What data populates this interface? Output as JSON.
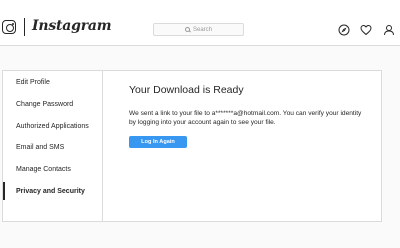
{
  "header": {
    "brand": "Instagram",
    "search_placeholder": "Search",
    "icons": [
      "instagram-glyph-icon",
      "search-icon",
      "explore-compass-icon",
      "activity-heart-icon",
      "profile-user-icon"
    ]
  },
  "sidebar": {
    "items": [
      {
        "label": "Edit Profile",
        "active": false
      },
      {
        "label": "Change Password",
        "active": false
      },
      {
        "label": "Authorized Applications",
        "active": false
      },
      {
        "label": "Email and SMS",
        "active": false
      },
      {
        "label": "Manage Contacts",
        "active": false
      },
      {
        "label": "Privacy and Security",
        "active": true
      }
    ]
  },
  "main": {
    "title": "Your Download is Ready",
    "message": "We sent a link to your file to a*******a@hotmail.com. You can verify your identity by logging into your account again to see your file.",
    "button_label": "Log In Again"
  },
  "colors": {
    "accent": "#3897f0",
    "border": "#dbdbdb",
    "background": "#fafafa",
    "text": "#262626"
  }
}
